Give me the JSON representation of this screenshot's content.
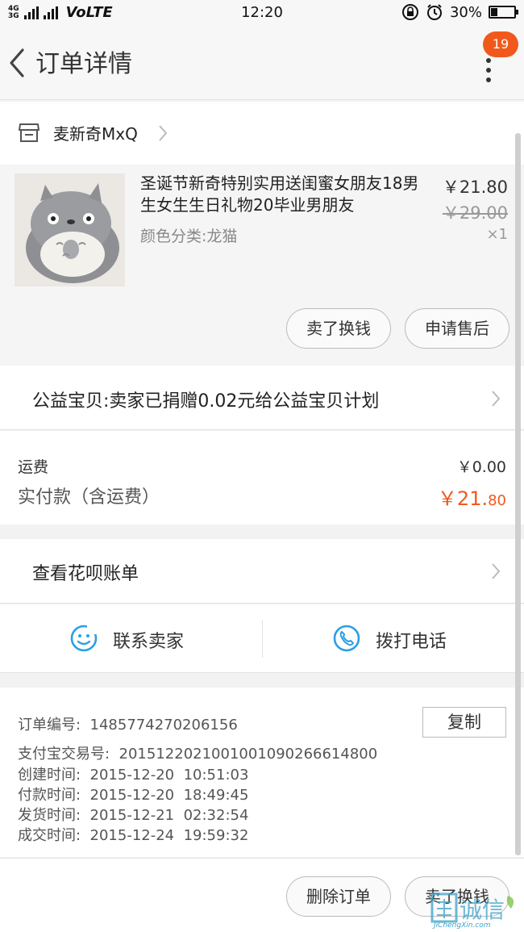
{
  "status": {
    "network_top": "4G",
    "network_bottom": "3G",
    "volte": "VoLTE",
    "time": "12:20",
    "battery": "30%",
    "battery_level": 0.3
  },
  "header": {
    "title": "订单详情",
    "badge": "19"
  },
  "shop": {
    "name": "麦新奇MxQ"
  },
  "item": {
    "title": "圣诞节新奇特别实用送闺蜜女朋友18男生女生生日礼物20毕业男朋友",
    "variant": "颜色分类:龙猫",
    "price": "￥21.80",
    "original_price": "￥29.00",
    "quantity": "×1",
    "actions": [
      "卖了换钱",
      "申请售后"
    ]
  },
  "charity": {
    "text": "公益宝贝:卖家已捐赠0.02元给公益宝贝计划"
  },
  "fees": {
    "shipping_label": "运费",
    "shipping_value": "￥0.00",
    "paid_label": "实付款（含运费）",
    "paid_value_main": "￥21.",
    "paid_value_cents": "80"
  },
  "huabei": {
    "text": "查看花呗账单"
  },
  "contact": {
    "seller": "联系卖家",
    "phone": "拨打电话"
  },
  "order_info": {
    "order_no_label": "订单编号:",
    "order_no": "1485774270206156",
    "copy": "复制",
    "alipay_label": "支付宝交易号:",
    "alipay_no": "2015122021001001090266614800",
    "created_label": "创建时间:",
    "created": "2015-12-20  10:51:03",
    "paid_label": "付款时间:",
    "paid": "2015-12-20  18:49:45",
    "shipped_label": "发货时间:",
    "shipped": "2015-12-21  02:32:54",
    "done_label": "成交时间:",
    "done": "2015-12-24  19:59:32"
  },
  "bottom": {
    "delete": "删除订单",
    "sell": "卖了换钱"
  },
  "watermark": {
    "text": "诚信",
    "sub": "JiChengXin.com"
  },
  "colors": {
    "accent": "#f1591c",
    "contact_blue": "#2b9fe6"
  }
}
